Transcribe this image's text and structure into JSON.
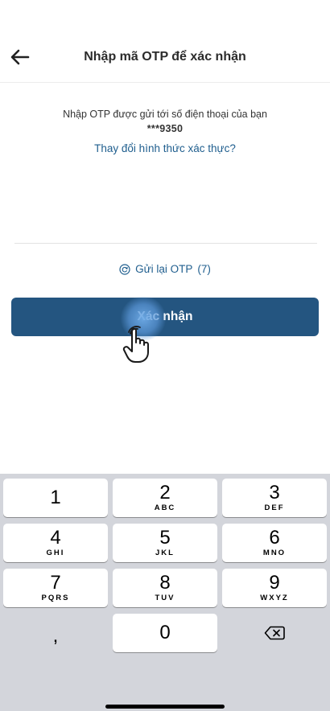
{
  "header": {
    "title": "Nhập mã OTP để xác nhận"
  },
  "content": {
    "instruction": "Nhập OTP được gửi tới số điện thoại của bạn",
    "phone": "***9350",
    "change_method": "Thay đổi hình thức xác thực?",
    "otp_value": ""
  },
  "resend": {
    "label": "Gửi lại OTP",
    "countdown": "(7)"
  },
  "confirm_button": {
    "label": "Xác nhận"
  },
  "keyboard": {
    "keys": [
      {
        "digit": "1",
        "letters": ""
      },
      {
        "digit": "2",
        "letters": "ABC"
      },
      {
        "digit": "3",
        "letters": "DEF"
      },
      {
        "digit": "4",
        "letters": "GHI"
      },
      {
        "digit": "5",
        "letters": "JKL"
      },
      {
        "digit": "6",
        "letters": "MNO"
      },
      {
        "digit": "7",
        "letters": "PQRS"
      },
      {
        "digit": "8",
        "letters": "TUV"
      },
      {
        "digit": "9",
        "letters": "WXYZ"
      },
      {
        "digit": ",",
        "letters": ""
      },
      {
        "digit": "0",
        "letters": ""
      }
    ]
  },
  "colors": {
    "primary_button": "#245580",
    "link": "#1f5e8e",
    "keyboard_bg": "#d3d5db"
  },
  "icons": {
    "back": "arrow-left-icon",
    "resend": "refresh-circle-icon",
    "backspace": "backspace-icon",
    "touch": "hand-pointer-icon"
  }
}
